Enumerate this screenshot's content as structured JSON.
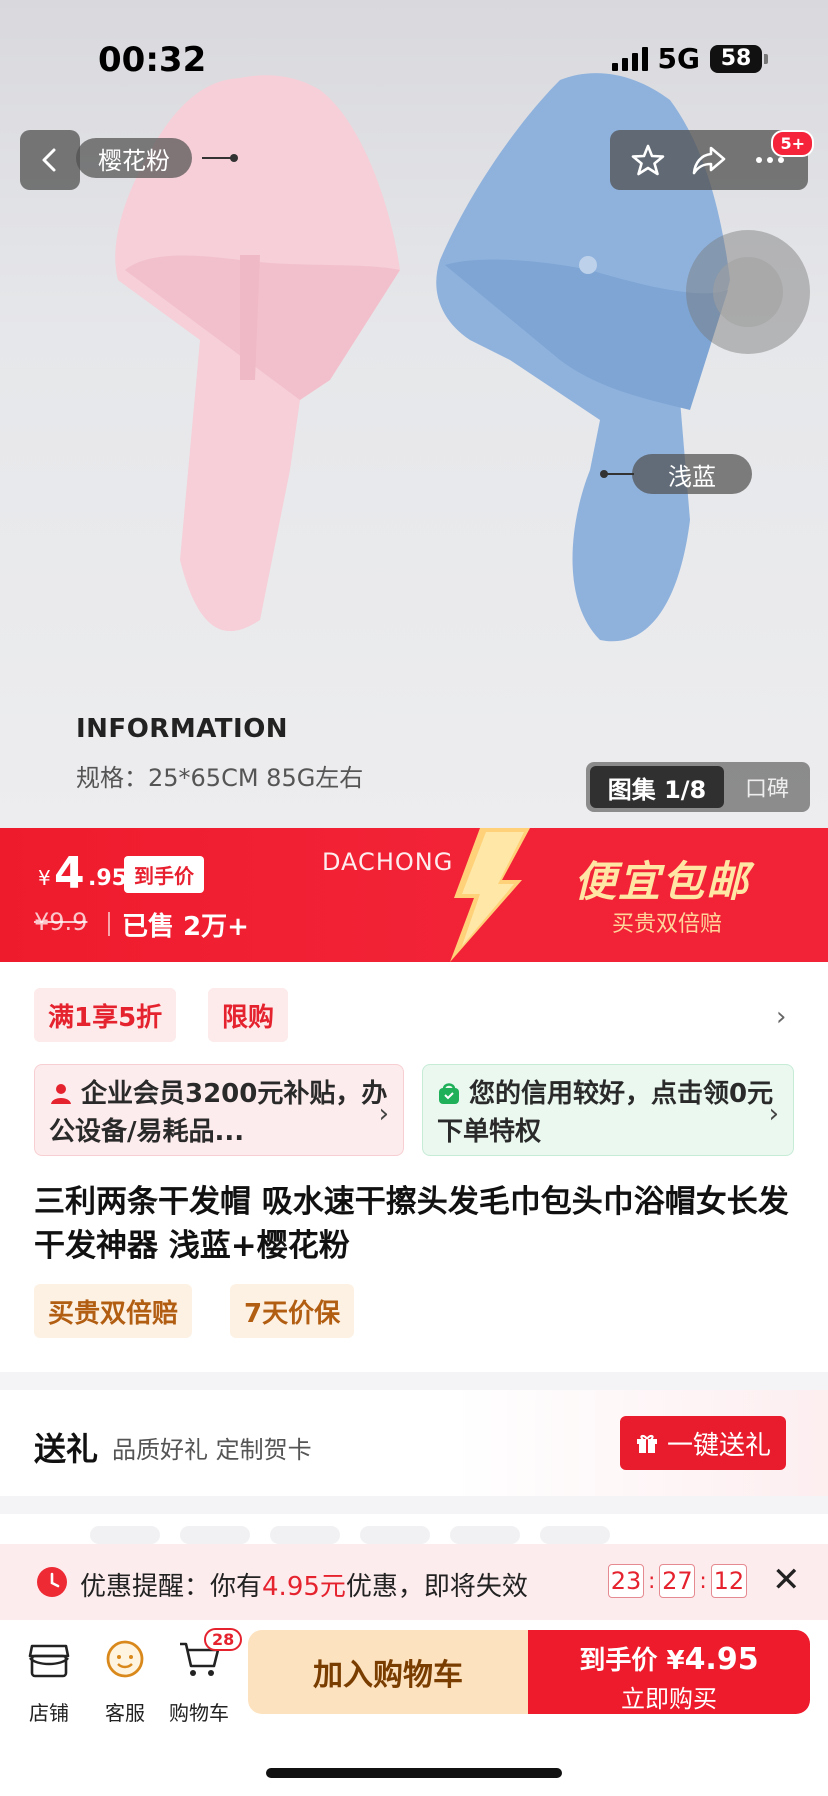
{
  "status": {
    "time": "00:32",
    "network": "5G",
    "battery": "58"
  },
  "hero": {
    "tag_pink": "樱花粉",
    "tag_blue": "浅蓝",
    "notify_badge": "5+",
    "info_title": "INFORMATION",
    "info_spec": "规格：25*65CM  85G左右",
    "gallery_label": "图集 1/8",
    "reviews_label": "口碑"
  },
  "price": {
    "currency": "¥",
    "int": "4",
    "dec": ".95",
    "tag": "到手价",
    "original": "¥9.9",
    "sold": "已售 2万+",
    "brand": "DACHONG",
    "promo_big": "便宜包邮",
    "promo_sub": "买贵双倍赔"
  },
  "chips": {
    "c1": "满1享5折",
    "c2": "限购"
  },
  "perks": {
    "red": "企业会员3200元补贴，办公设备/易耗品...",
    "green": "您的信用较好，点击领0元下单特权"
  },
  "product": {
    "title": "三利两条干发帽 吸水速干擦头发毛巾包头巾浴帽女长发干发神器 浅蓝+樱花粉",
    "guarantee1": "买贵双倍赔",
    "guarantee2": "7天价保"
  },
  "gift": {
    "title": "送礼",
    "sub": "品质好礼 定制贺卡",
    "button": "一键送礼"
  },
  "reminder": {
    "prefix": "优惠提醒：你有",
    "amount": "4.95元",
    "suffix": "优惠，即将失效",
    "hh": "23",
    "mm": "27",
    "ss": "12"
  },
  "bottom": {
    "store": "店铺",
    "service": "客服",
    "cart": "购物车",
    "cart_count": "28",
    "add_cart": "加入购物车",
    "buy_label": "到手价",
    "buy_currency": "¥",
    "buy_price": "4.95",
    "buy_now": "立即购买"
  }
}
